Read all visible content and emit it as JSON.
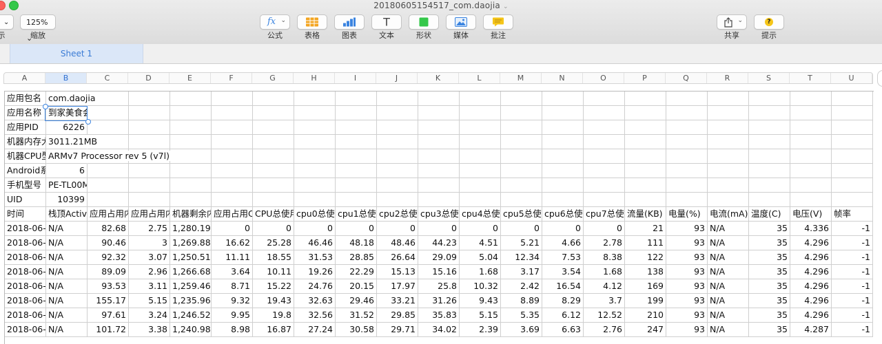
{
  "window": {
    "title": "20180605154517_com.daojia"
  },
  "toolbar": {
    "view_label": "示",
    "zoom": {
      "value": "125%",
      "label": "缩放"
    },
    "formula": {
      "glyph": "fx",
      "label": "公式"
    },
    "table_label": "表格",
    "chart_label": "图表",
    "text": {
      "glyph": "T",
      "label": "文本"
    },
    "shape_label": "形状",
    "media_label": "媒体",
    "comment_label": "批注",
    "share_label": "共享",
    "tips": {
      "glyph": "?",
      "label": "提示"
    }
  },
  "sheet": {
    "tab": "Sheet 1"
  },
  "columns": [
    "A",
    "B",
    "C",
    "D",
    "E",
    "F",
    "G",
    "H",
    "I",
    "J",
    "K",
    "L",
    "M",
    "N",
    "O",
    "P",
    "Q",
    "R",
    "S",
    "T",
    "U"
  ],
  "selected_column": "B",
  "colors": {
    "accent": "#3b84e0",
    "sheet_tab_bg": "#dbe7f8",
    "green": "#34c84a",
    "yellow": "#f5c518"
  },
  "info_rows": [
    {
      "label": "应用包名",
      "value": "com.daojia",
      "align": "left"
    },
    {
      "label": "应用名称",
      "value": "到家美食会",
      "align": "left"
    },
    {
      "label": "应用PID",
      "value": "6226",
      "align": "right"
    },
    {
      "label": "机器内存大",
      "value": "3011.21MB",
      "align": "left"
    },
    {
      "label": "机器CPU型",
      "value": "ARMv7 Processor rev 5 (v7l)",
      "align": "left"
    },
    {
      "label": "Android系",
      "value": "6",
      "align": "right"
    },
    {
      "label": "手机型号",
      "value": "PE-TL00M",
      "align": "left"
    },
    {
      "label": "UID",
      "value": "10399",
      "align": "right"
    }
  ],
  "table": {
    "headers": [
      "时间",
      "栈顶Activi",
      "应用占用内",
      "应用占用内",
      "机器剩余内",
      "应用占用C",
      "CPU总使用",
      "cpu0总使",
      "cpu1总使",
      "cpu2总使",
      "cpu3总使",
      "cpu4总使",
      "cpu5总使",
      "cpu6总使",
      "cpu7总使",
      "流量(KB)",
      "电量(%)",
      "电流(mA)",
      "温度(C)",
      "电压(V)",
      "帧率"
    ],
    "rows": [
      [
        "2018-06-",
        "N/A",
        "82.68",
        "2.75",
        "1,280.19",
        "0",
        "0",
        "0",
        "0",
        "0",
        "0",
        "0",
        "0",
        "0",
        "0",
        "21",
        "93",
        "N/A",
        "35",
        "4.336",
        "-1"
      ],
      [
        "2018-06-",
        "N/A",
        "90.46",
        "3",
        "1,269.88",
        "16.62",
        "25.28",
        "46.46",
        "48.18",
        "48.46",
        "44.23",
        "4.51",
        "5.21",
        "4.66",
        "2.78",
        "111",
        "93",
        "N/A",
        "35",
        "4.296",
        "-1"
      ],
      [
        "2018-06-",
        "N/A",
        "92.32",
        "3.07",
        "1,250.51",
        "11.11",
        "18.55",
        "31.53",
        "28.85",
        "26.64",
        "29.09",
        "5.04",
        "12.34",
        "7.53",
        "8.38",
        "122",
        "93",
        "N/A",
        "35",
        "4.296",
        "-1"
      ],
      [
        "2018-06-",
        "N/A",
        "89.09",
        "2.96",
        "1,266.68",
        "3.64",
        "10.11",
        "19.26",
        "22.29",
        "15.13",
        "15.16",
        "1.68",
        "3.17",
        "3.54",
        "1.68",
        "138",
        "93",
        "N/A",
        "35",
        "4.296",
        "-1"
      ],
      [
        "2018-06-",
        "N/A",
        "93.53",
        "3.11",
        "1,259.46",
        "8.71",
        "15.22",
        "24.76",
        "20.15",
        "17.97",
        "25.8",
        "10.32",
        "2.42",
        "16.54",
        "4.12",
        "169",
        "93",
        "N/A",
        "35",
        "4.296",
        "-1"
      ],
      [
        "2018-06-",
        "N/A",
        "155.17",
        "5.15",
        "1,235.96",
        "9.32",
        "19.43",
        "32.63",
        "29.46",
        "33.21",
        "31.26",
        "9.43",
        "8.89",
        "8.29",
        "3.7",
        "199",
        "93",
        "N/A",
        "35",
        "4.296",
        "-1"
      ],
      [
        "2018-06-",
        "N/A",
        "97.61",
        "3.24",
        "1,246.52",
        "9.95",
        "19.8",
        "32.56",
        "31.52",
        "29.85",
        "35.83",
        "5.15",
        "5.35",
        "6.12",
        "12.52",
        "210",
        "93",
        "N/A",
        "35",
        "4.296",
        "-1"
      ],
      [
        "2018-06-",
        "N/A",
        "101.72",
        "3.38",
        "1,240.98",
        "8.98",
        "16.87",
        "27.24",
        "30.58",
        "29.71",
        "34.02",
        "2.39",
        "3.69",
        "6.63",
        "2.76",
        "247",
        "93",
        "N/A",
        "35",
        "4.287",
        "-1"
      ]
    ]
  }
}
